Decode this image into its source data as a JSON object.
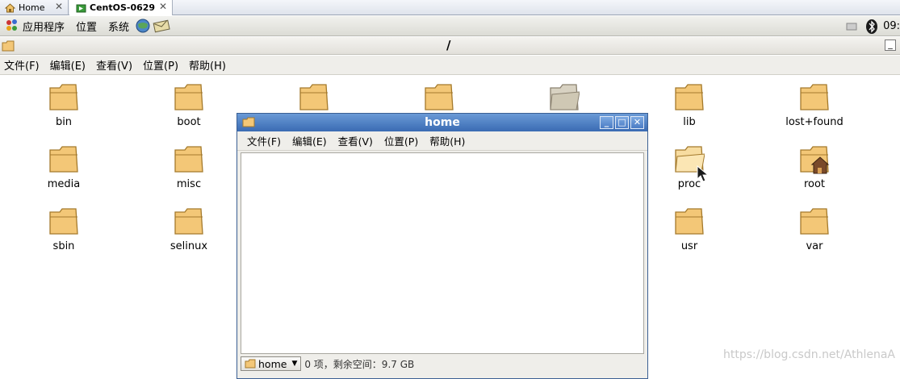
{
  "tabs": [
    {
      "label": "Home",
      "close": "✕"
    },
    {
      "label": "CentOS-0629",
      "close": "✕"
    }
  ],
  "panel": {
    "applications": "应用程序",
    "places": "位置",
    "system": "系统",
    "clock": "09:"
  },
  "window": {
    "location": "/",
    "minimize": "_"
  },
  "menubar": {
    "file": "文件(F)",
    "edit": "编辑(E)",
    "view": "查看(V)",
    "go": "位置(P)",
    "help": "帮助(H)"
  },
  "folders": {
    "bin": "bin",
    "boot": "boot",
    "lib": "lib",
    "lost_found": "lost+found",
    "media": "media",
    "misc": "misc",
    "proc": "proc",
    "root": "root",
    "sbin": "sbin",
    "selinux": "selinux",
    "usr": "usr",
    "var": "var"
  },
  "popup": {
    "title": "home",
    "min": "_",
    "max": "□",
    "close": "✕",
    "menu": {
      "file": "文件(F)",
      "edit": "编辑(E)",
      "view": "查看(V)",
      "go": "位置(P)",
      "help": "帮助(H)"
    },
    "path_combo": "home",
    "status": "0 项，剩余空间：9.7 GB"
  },
  "watermark": "https://blog.csdn.net/AthlenaA",
  "colors": {
    "folder_fill": "#f3c777",
    "folder_stroke": "#a47a2c",
    "title_blue": "#3a6bb3"
  }
}
